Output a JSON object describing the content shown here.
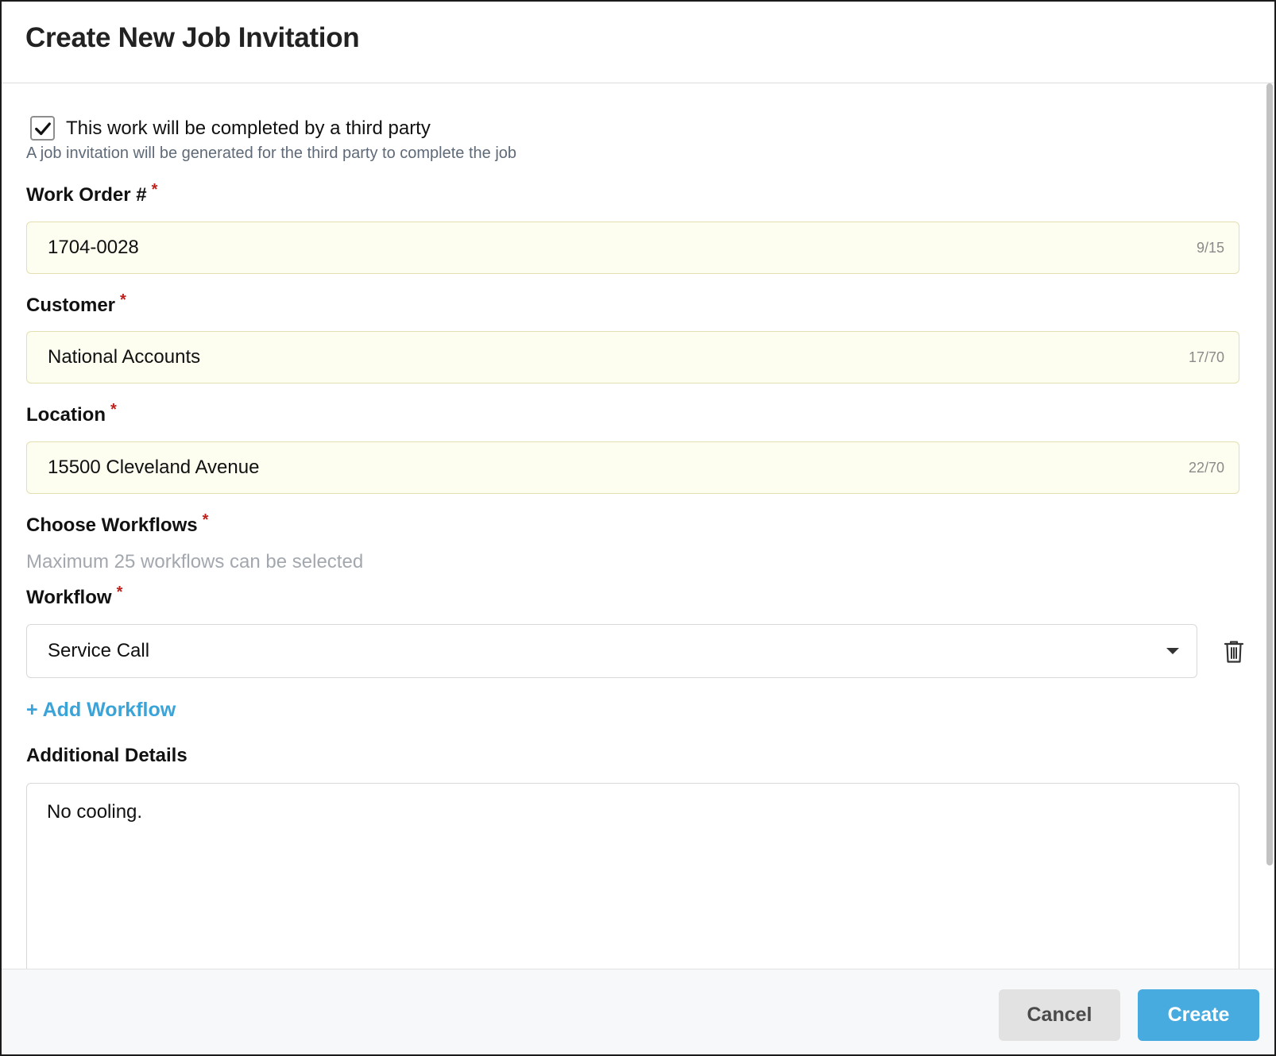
{
  "dialog": {
    "title": "Create New Job Invitation"
  },
  "third_party": {
    "checked": true,
    "label": "This work will be completed by a third party",
    "help": "A job invitation will be generated for the third party to complete the job"
  },
  "work_order": {
    "label": "Work Order #",
    "required_mark": "*",
    "value": "1704-0028",
    "counter": "9/15"
  },
  "customer": {
    "label": "Customer",
    "required_mark": "*",
    "value": "National Accounts",
    "counter": "17/70"
  },
  "location": {
    "label": "Location",
    "required_mark": "*",
    "value": "15500 Cleveland Avenue",
    "counter": "22/70"
  },
  "workflows": {
    "label": "Choose Workflows",
    "required_mark": "*",
    "hint": "Maximum 25 workflows can be selected",
    "workflow_label": "Workflow",
    "workflow_value": "Service Call",
    "add_label": "+ Add Workflow"
  },
  "additional_details": {
    "label": "Additional Details",
    "value": "No cooling."
  },
  "footer": {
    "cancel_label": "Cancel",
    "create_label": "Create"
  },
  "colors": {
    "accent": "#47abe0",
    "link": "#3aa3d8",
    "required": "#c0201c",
    "input_fill": "#fefef0"
  },
  "icons": {
    "checkbox": "check-icon",
    "select": "caret-down-icon",
    "delete": "trash-icon"
  }
}
